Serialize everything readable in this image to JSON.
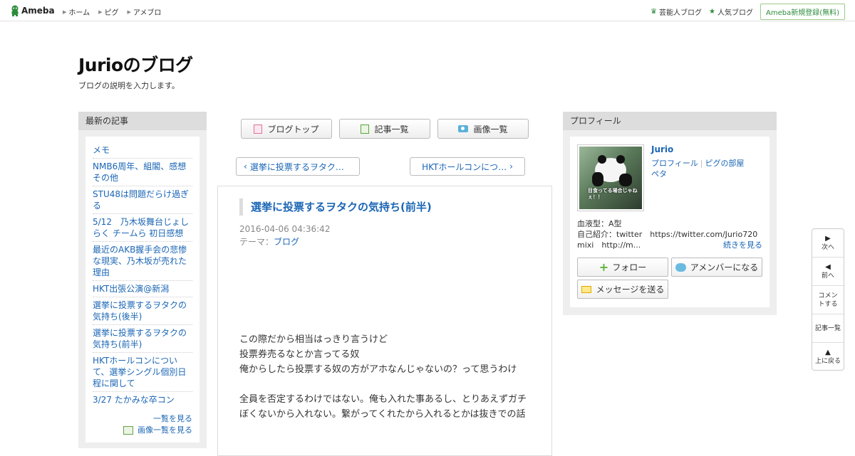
{
  "topbar": {
    "logo": "Ameba",
    "nav": [
      "ホーム",
      "ピグ",
      "アメブロ"
    ],
    "right": [
      {
        "label": "芸能人ブログ",
        "icon": "crown-icon"
      },
      {
        "label": "人気ブログ",
        "icon": "star-icon"
      }
    ],
    "signup": "Ameba新規登録(無料)"
  },
  "blog": {
    "title": "Jurioのブログ",
    "description": "ブログの説明を入力します。"
  },
  "sidebar_left": {
    "heading": "最新の記事",
    "articles": [
      "メモ",
      "NMB6周年、組閣、感想その他",
      "STU48は問題だらけ過ぎる",
      "5/12　乃木坂舞台じょしらく チームら 初日感想",
      "最近のAKB握手会の悲惨な現実、乃木坂が売れた理由",
      "HKT出張公演@新潟",
      "選挙に投票するヲタクの気持ち(後半)",
      "選挙に投票するヲタクの気持ち(前半)",
      "HKTホールコンについて、選挙シングル個別日程に関して",
      "3/27 たかみな卒コン"
    ],
    "see_list": "一覧を見る",
    "see_images": "画像一覧を見る"
  },
  "center": {
    "tabs": [
      "ブログトップ",
      "記事一覧",
      "画像一覧"
    ],
    "prev": "選挙に投票するヲタク…",
    "next": "HKTホールコンにつ…",
    "entry": {
      "title": "選挙に投票するヲタクの気持ち(前半)",
      "date": "2016-04-06 04:36:42",
      "theme_label": "テーマ：",
      "theme": "ブログ",
      "body": [
        "この際だから相当はっきり言うけど",
        "投票券売るなとか言ってる奴",
        "俺からしたら投票する奴の方がアホなんじゃないの？って思うわけ",
        "",
        "全員を否定するわけではない。俺も入れた事あるし、とりあえずガチぼくないから入れない。繋がってくれたから入れるとかは抜きでの話"
      ]
    }
  },
  "sidebar_right": {
    "heading": "プロフィール",
    "name": "Jurio",
    "image_caption": "目食ってる場合じゃねぇ！！",
    "links": [
      "プロフィール",
      "ピグの部屋",
      "ペタ"
    ],
    "blood_type": "血液型：A型",
    "intro1": "自己紹介：twitter　https://twitter.com/Jurio720",
    "intro2": "mixi　http://m...",
    "read_more": "続きを見る",
    "follow": "フォロー",
    "amember": "アメンバーになる",
    "message": "メッセージを送る"
  },
  "floatnav": {
    "next": "次へ",
    "prev": "前へ",
    "comment": "コメントする",
    "list": "記事一覧",
    "top": "上に戻る"
  },
  "colors": {
    "link": "#1b66b5",
    "ameba_green": "#2d8c3c",
    "sidebar_bg": "#eeeeee"
  }
}
